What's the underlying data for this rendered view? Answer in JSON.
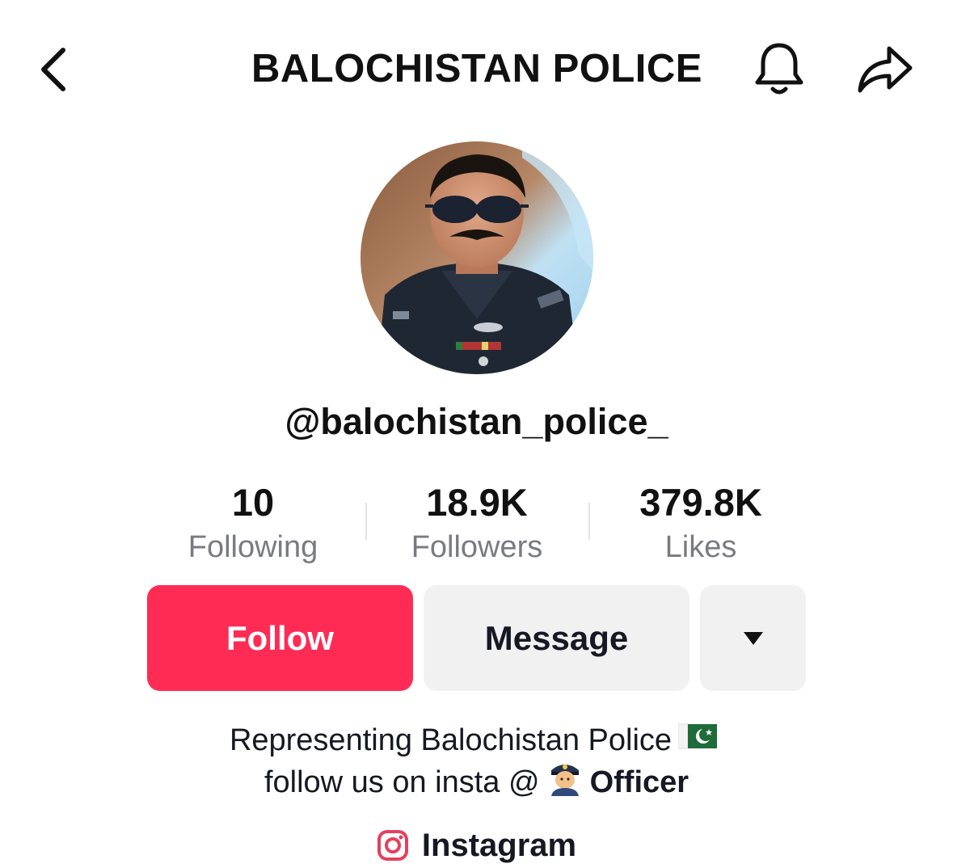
{
  "header": {
    "title": "BALOCHISTAN POLICE",
    "back_icon": "chevron-left-icon",
    "bell_icon": "bell-icon",
    "share_icon": "share-arrow-icon"
  },
  "profile": {
    "username": "@balochistan_police_",
    "avatar": "police-officer-avatar"
  },
  "stats": [
    {
      "value": "10",
      "label": "Following"
    },
    {
      "value": "18.9K",
      "label": "Followers"
    },
    {
      "value": "379.8K",
      "label": "Likes"
    }
  ],
  "actions": {
    "follow_label": "Follow",
    "message_label": "Message",
    "more_icon": "caret-down-icon"
  },
  "bio": {
    "line1_text": "Representing Balochistan Police",
    "line1_emoji": "pakistan-flag-icon",
    "line2_text": "follow us on insta @",
    "line2_emoji": "police-officer-emoji-icon",
    "line2_bold": "Officer"
  },
  "link": {
    "icon": "instagram-icon",
    "label": "Instagram"
  },
  "colors": {
    "follow": "#fe2c55",
    "secondary_button": "#f1f1f2",
    "muted_text": "#7a7b80"
  }
}
